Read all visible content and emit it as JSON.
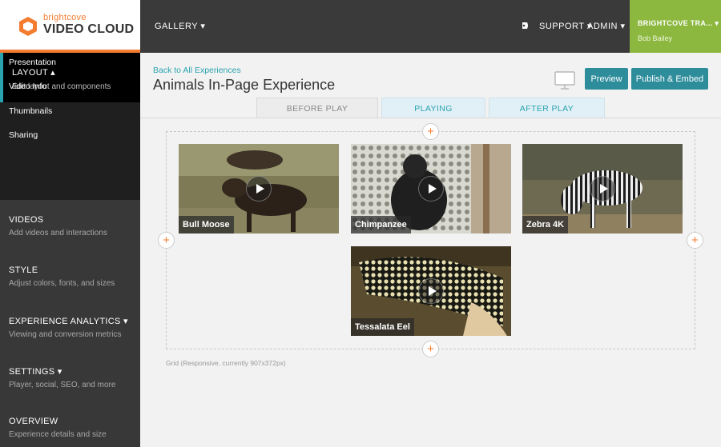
{
  "brand": {
    "small": "brightcove",
    "name": "VIDEO CLOUD"
  },
  "topnav": {
    "gallery": "GALLERY ▾",
    "support": "SUPPORT ▾",
    "admin": "ADMIN ▾",
    "account_name": "BRIGHTCOVE TRA... ▾",
    "account_user": "Bob Bailey"
  },
  "sidebar": {
    "active": {
      "title": "LAYOUT ▴",
      "subtitle": "Edit layout and components"
    },
    "subitems": [
      "Presentation",
      "Video Info",
      "Thumbnails",
      "Sharing"
    ],
    "sections": [
      {
        "title": "VIDEOS",
        "subtitle": "Add videos and interactions"
      },
      {
        "title": "STYLE",
        "subtitle": "Adjust colors, fonts, and sizes"
      },
      {
        "title": "EXPERIENCE ANALYTICS ▾",
        "subtitle": "Viewing and conversion metrics"
      },
      {
        "title": "SETTINGS ▾",
        "subtitle": "Player, social, SEO, and more"
      },
      {
        "title": "OVERVIEW",
        "subtitle": "Experience details and size"
      }
    ]
  },
  "main": {
    "back_link": "Back to All Experiences",
    "title": "Animals In-Page Experience",
    "preview_label": "Preview",
    "publish_label": "Publish & Embed",
    "tabs": [
      "BEFORE PLAY",
      "PLAYING",
      "AFTER PLAY"
    ],
    "active_tab": "BEFORE PLAY",
    "grid_caption": "Grid (Responsive, currently 907x372px)",
    "plus_symbol": "+"
  },
  "videos": [
    {
      "title": "Bull Moose"
    },
    {
      "title": "Chimpanzee"
    },
    {
      "title": "Zebra 4K"
    },
    {
      "title": "Tessalata Eel"
    }
  ],
  "colors": {
    "accent_teal": "#2aa3b0",
    "button_teal": "#2e8d9b",
    "brand_orange": "#f47c30",
    "account_green": "#8cb83f",
    "topbar": "#3a3a3a"
  },
  "icons": [
    "brightcove-logo-icon",
    "notification-icon",
    "monitor-icon",
    "play-icon",
    "plus-icon"
  ]
}
